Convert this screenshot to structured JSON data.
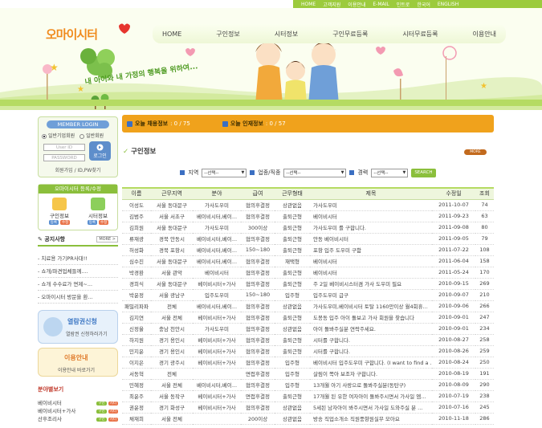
{
  "top_links": [
    "HOME",
    "고객지원",
    "이용안내",
    "E-MAIL",
    "인트로",
    "한국어",
    "ENGLISH"
  ],
  "logo": "오마이시터",
  "nav": [
    "HOME",
    "구인정보",
    "시터정보",
    "구인무료등록",
    "시터무료등록",
    "이용안내"
  ],
  "slogan": "내 아이와 내 가정의 행복을 위하여...",
  "login": {
    "title": "MEMBER LOGIN",
    "radio_general": "일반기업회원",
    "radio_personal": "일반회원",
    "user_id_placeholder": "User ID",
    "password_placeholder": "PASSWORD",
    "login_button": "로그인",
    "join_link": "회원가입 / ID,PW찾기"
  },
  "registration": {
    "title": "오마이시터 등록/수정",
    "job": "구인정보",
    "sitter": "시터정보",
    "tag_register": "등록",
    "tag_edit": "수정"
  },
  "notice": {
    "title": "공지사항",
    "more": "MORE >",
    "items": [
      "- 치료용 가기PR사대!!",
      "- 쇼개/파견업체들께....",
      "- 쇼개 수수료가 면제~...",
      "- 오마이시터 방문을 환..."
    ]
  },
  "banner1": {
    "title": "열람권신청",
    "sub": "열람권 신청하러가기"
  },
  "banner2": {
    "title": "이용안내",
    "sub": "이용안내 바로가기"
  },
  "category": {
    "title": "분야별보기",
    "items": [
      {
        "label": "베이비시터",
        "tag1": "구인",
        "tag2": "시터"
      },
      {
        "label": "베이비시터+가사",
        "tag1": "구인",
        "tag2": "시터"
      },
      {
        "label": "산후조리사",
        "tag1": "구인",
        "tag2": "시터"
      }
    ]
  },
  "tabs": [
    {
      "label": "오늘 채용정보",
      "count": ": 0 / 75"
    },
    {
      "label": "오늘 인재정보",
      "count": ": 0 / 57"
    }
  ],
  "section_title": "구인정보",
  "more_button": "MORE",
  "search": {
    "region_label": "지역",
    "region_value": "--선택--",
    "job_label": "업종/직종",
    "job_value": "--선택--",
    "career_label": "경력",
    "career_value": "--선택--",
    "button": "SEARCH"
  },
  "table": {
    "headers": [
      "이름",
      "근무지역",
      "분야",
      "급여",
      "근무형태",
      "제목",
      "수정일",
      "조회"
    ],
    "rows": [
      [
        "이성도",
        "서울 동대문구",
        "가사도우미",
        "협의후결정",
        "상관없음",
        "가사도우미",
        "2011-10-07",
        "74"
      ],
      [
        "김범주",
        "서울 서초구",
        "베이비시터,베이...",
        "협의후결정",
        "출퇴근형",
        "베이비시터",
        "2011-09-23",
        "63"
      ],
      [
        "김희원",
        "서울 동대문구",
        "가사도우미",
        "300이상",
        "출퇴근형",
        "가사도우미 를 구합니다.",
        "2011-09-08",
        "80"
      ],
      [
        "류재광",
        "경북 안동시",
        "베이비시터,베이...",
        "협의후결정",
        "출퇴근형",
        "안동 베이비시터",
        "2011-09-05",
        "79"
      ],
      [
        "허성화",
        "경북 포항시",
        "베이비시터,베이...",
        "150~180",
        "출퇴근형",
        "포항 입주 도우미 구함",
        "2011-07-22",
        "108"
      ],
      [
        "심수진",
        "서울 동대문구",
        "베이비시터,베이...",
        "협의후결정",
        "재택형",
        "베이비시터",
        "2011-06-04",
        "158"
      ],
      [
        "박경환",
        "서울 관악",
        "베이비시터",
        "협의후결정",
        "출퇴근형",
        "베이비시터",
        "2011-05-24",
        "170"
      ],
      [
        "경희식",
        "서울 동대문구",
        "베이비시터+가사",
        "협의후결정",
        "출퇴근형",
        "주 2일 베이비시스터겸 가사 도우미 필요",
        "2010-09-15",
        "269"
      ],
      [
        "박윤정",
        "서울 광남구",
        "입주도우미",
        "150~180",
        "입주형",
        "입주도우미 급구",
        "2010-09-07",
        "210"
      ],
      [
        "패밀리파파",
        "전체",
        "베이비시터,베이...",
        "협의후결정",
        "상관없음",
        "가사도우미,베이비시터 토탈 1160만이상 월4회휴...",
        "2010-09-06",
        "266"
      ],
      [
        "김지연",
        "서울 전체",
        "베이비시터+가사",
        "협의후결정",
        "출퇴근형",
        "도봉동 입주 아이 돌보고 가사 회원을 찾습니다",
        "2010-09-01",
        "247"
      ],
      [
        "신정율",
        "충남 천안시",
        "가사도우미",
        "협의후결정",
        "상관없음",
        "아이 돌봐주실분 연락주세요.",
        "2010-09-01",
        "234"
      ],
      [
        "하지원",
        "경기 용인시",
        "베이비시터+가사",
        "협의후결정",
        "출퇴근형",
        "시터를 구합니다.",
        "2010-08-27",
        "258"
      ],
      [
        "민지윤",
        "경기 용인시",
        "베이비시터+가사",
        "협의후결정",
        "출퇴근형",
        "시터를 구합니다.",
        "2010-08-26",
        "259"
      ],
      [
        "이지은",
        "경기 광주시",
        "베이비시터+가사",
        "협의후결정",
        "입주형",
        "베이비시터 입주도우미 구합니다. (I want to find a ...",
        "2010-08-24",
        "250"
      ],
      [
        "서동혁",
        "전체",
        "",
        "면접후결정",
        "입주형",
        "살림이 쪽아 보조자 구합니다.",
        "2010-08-19",
        "191"
      ],
      [
        "민혜정",
        "서울 전체",
        "베이비시터,베이...",
        "협의후결정",
        "입주형",
        "13개월 아기 사랑으로 돌봐주실분(동탄구)",
        "2010-08-09",
        "290"
      ],
      [
        "최윤주",
        "서울 동작구",
        "베이비시터+가사",
        "면접후결정",
        "출퇴근형",
        "17개월 된 유한 여자아이 돌봐주시면서 가사일 엠...",
        "2010-07-19",
        "238"
      ],
      [
        "권윤정",
        "경기 화성구",
        "베이비시터+가사",
        "협의후결정",
        "상관없음",
        "5세된 남자아이 봐주시면서 가사일 도와주실 분 ...",
        "2010-07-16",
        "245"
      ],
      [
        "채재희",
        "서울 전체",
        "",
        "200이상",
        "상관없음",
        "방송 직업소개소 직원풍향원실무 모아요",
        "2010-11-18",
        "286"
      ]
    ]
  }
}
